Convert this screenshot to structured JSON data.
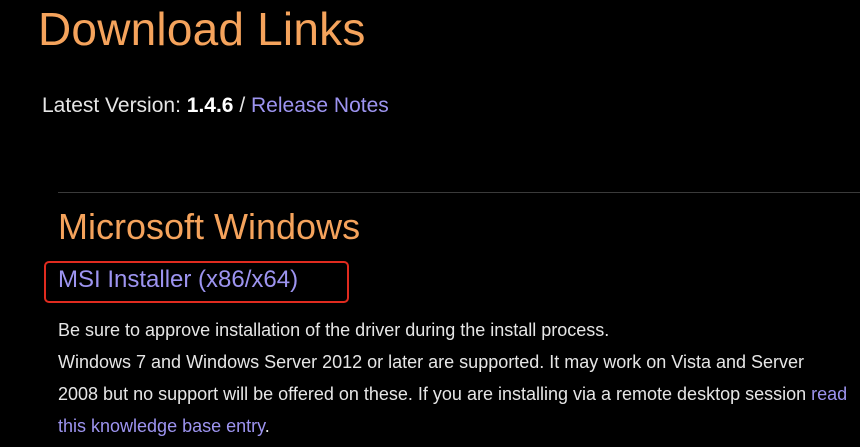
{
  "page": {
    "title": "Download Links",
    "version_label": "Latest Version:",
    "version_number": "1.4.6",
    "separator": "/",
    "release_notes_link": "Release Notes"
  },
  "windows_section": {
    "title": "Microsoft Windows",
    "installer_link": "MSI Installer (x86/x64)",
    "line1": "Be sure to approve installation of the driver during the install process.",
    "line2": "Windows 7 and Windows Server 2012 or later are supported. It may work on Vista and Server 2008 but no support will be offered on these. If you are installing via a remote desktop session ",
    "kb_link": "read this knowledge base entry",
    "line2_end": "."
  },
  "colors": {
    "heading": "#f5a35c",
    "link": "#9d94f0",
    "text": "#e6e6e6",
    "highlight_box": "#e02b1f",
    "background": "#000000"
  }
}
